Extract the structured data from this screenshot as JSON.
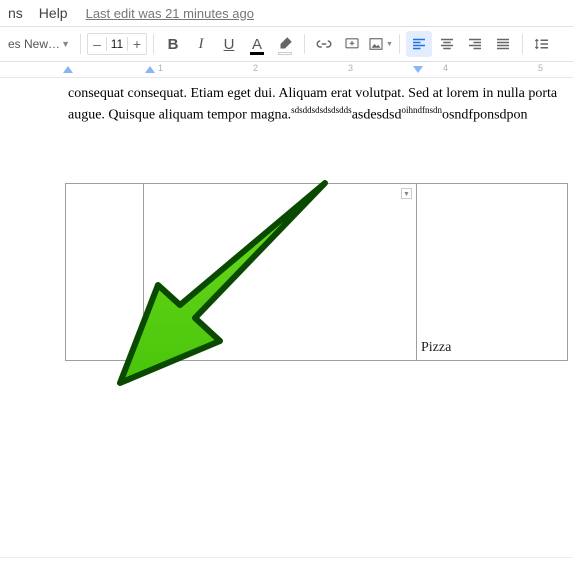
{
  "menubar": {
    "items": [
      "ns",
      "Help"
    ],
    "edit_info": "Last edit was 21 minutes ago"
  },
  "toolbar": {
    "font_name": "es New…",
    "font_size": "11",
    "minus": "–",
    "plus": "+",
    "bold": "B",
    "italic": "I",
    "underline": "U",
    "textcolor": "A"
  },
  "ruler": {
    "nums": [
      "1",
      "2",
      "3",
      "4",
      "5"
    ]
  },
  "doc": {
    "line1": "consequat consequat. Etiam eget dui. Aliquam erat volutpat. Sed at lorem in nulla porta",
    "line2a": "augue. Quisque aliquam tempor magna.",
    "sup1": "sdsddsdsdsdsdds",
    "line2b": "asdesdsd",
    "sup2": "oihndfnsdn",
    "line2c": "osndfponsdpon"
  },
  "table": {
    "cell_pizza": "Pizza"
  }
}
